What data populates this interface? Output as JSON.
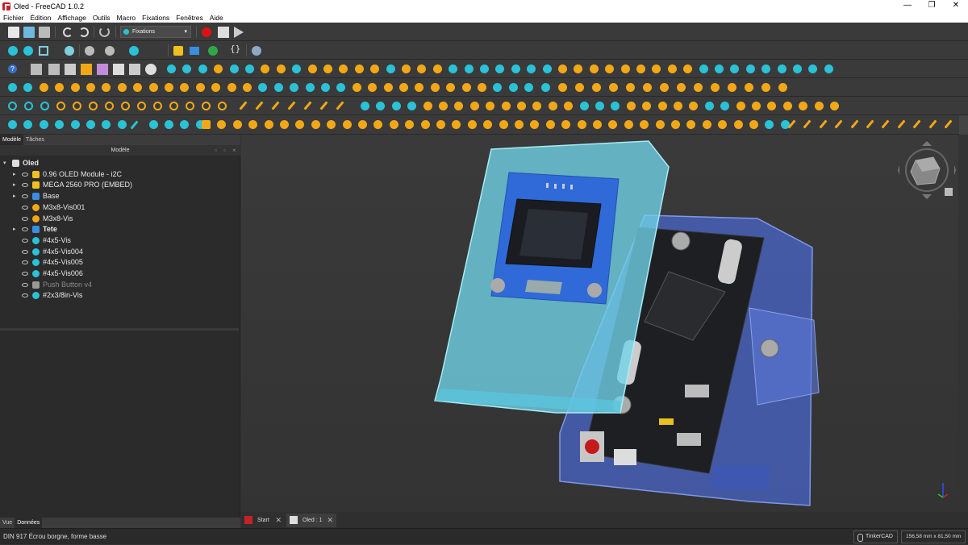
{
  "window": {
    "title": "Oled - FreeCAD 1.0.2",
    "minimize": "—",
    "restore": "❐",
    "close": "✕"
  },
  "menu": [
    "Fichier",
    "Édition",
    "Affichage",
    "Outils",
    "Macro",
    "Fixations",
    "Fenêtres",
    "Aide"
  ],
  "toolbar": {
    "workbench": "Fixations"
  },
  "panel": {
    "tabs": [
      "Modèle",
      "Tâches"
    ],
    "title": "Modèle",
    "bottom_tabs": [
      "Vue",
      "Données"
    ]
  },
  "tree": [
    {
      "label": "Oled",
      "level": 0,
      "expanded": true,
      "icon": "document-icon",
      "bold": true
    },
    {
      "label": "0.96 OLED Module - i2C",
      "level": 1,
      "arrow": true,
      "icon": "part-icon"
    },
    {
      "label": "MEGA 2560 PRO (EMBED)",
      "level": 1,
      "arrow": true,
      "icon": "part-icon"
    },
    {
      "label": "Base",
      "level": 1,
      "arrow": true,
      "icon": "body-icon"
    },
    {
      "label": "M3x8-Vis001",
      "level": 1,
      "icon": "screw-icon"
    },
    {
      "label": "M3x8-Vis",
      "level": 1,
      "icon": "screw-icon"
    },
    {
      "label": "Tete",
      "level": 1,
      "arrow": true,
      "icon": "body-icon",
      "bold": true
    },
    {
      "label": "#4x5-Vis",
      "level": 1,
      "icon": "screw-cyan-icon"
    },
    {
      "label": "#4x5-Vis004",
      "level": 1,
      "icon": "screw-cyan-icon"
    },
    {
      "label": "#4x5-Vis005",
      "level": 1,
      "icon": "screw-cyan-icon"
    },
    {
      "label": "#4x5-Vis006",
      "level": 1,
      "icon": "screw-cyan-icon"
    },
    {
      "label": "Push Button v4",
      "level": 1,
      "icon": "part-gray-icon",
      "dim": true
    },
    {
      "label": "#2x3/8in-Vis",
      "level": 1,
      "icon": "screw-cyan-icon"
    }
  ],
  "doc_tabs": [
    {
      "label": "Start"
    },
    {
      "label": "Oled : 1"
    }
  ],
  "status": {
    "message": "DIN 917 Écrou borgne, forme basse",
    "navigation": "TinkerCAD",
    "dimensions": "156,58 mm x 81,50 mm"
  },
  "colors": {
    "fastener_orange": "#f2a816",
    "fastener_cyan": "#29c2d6",
    "case_front": "#6fd4e8",
    "case_back": "#4a66c8",
    "pcb": "#1e1f22"
  }
}
